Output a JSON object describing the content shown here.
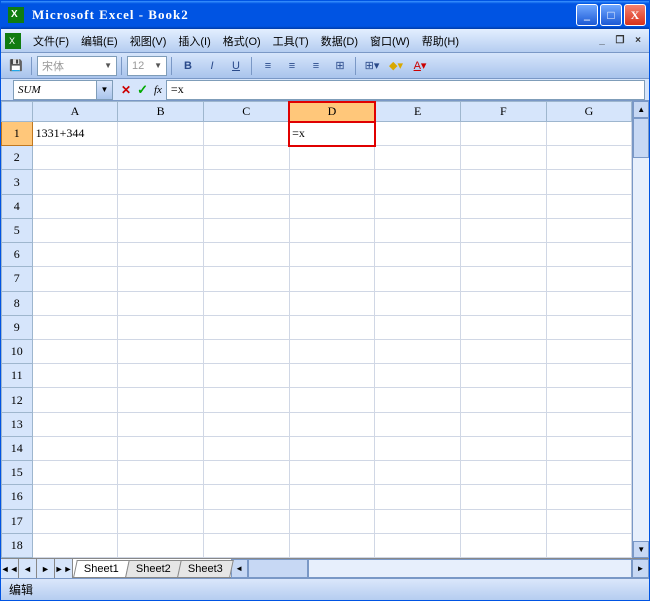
{
  "title": "Microsoft Excel - Book2",
  "menu": {
    "file": "文件(F)",
    "edit": "编辑(E)",
    "view": "视图(V)",
    "insert": "插入(I)",
    "format": "格式(O)",
    "tools": "工具(T)",
    "data": "数据(D)",
    "window": "窗口(W)",
    "help": "帮助(H)"
  },
  "toolbar": {
    "font": "宋体",
    "size": "12",
    "bold": "B",
    "italic": "I",
    "under": "U"
  },
  "fbar": {
    "namebox": "SUM",
    "fx": "fx",
    "formula": "=x",
    "cancel": "✕",
    "enter": "✓"
  },
  "grid": {
    "cols": [
      "A",
      "B",
      "C",
      "D",
      "E",
      "F",
      "G"
    ],
    "rows": [
      "1",
      "2",
      "3",
      "4",
      "5",
      "6",
      "7",
      "8",
      "9",
      "10",
      "11",
      "12",
      "13",
      "14",
      "15",
      "16",
      "17",
      "18"
    ],
    "active_col": "D",
    "active_row": "1",
    "cells": {
      "A1": "1331+344",
      "D1": "=x"
    }
  },
  "sheets": {
    "s1": "Sheet1",
    "s2": "Sheet2",
    "s3": "Sheet3"
  },
  "status": "编辑",
  "nav": {
    "first": "◄◄",
    "prev": "◄",
    "next": "►",
    "last": "►►"
  },
  "sbar": {
    "up": "▲",
    "down": "▼",
    "left": "◄",
    "right": "►"
  }
}
